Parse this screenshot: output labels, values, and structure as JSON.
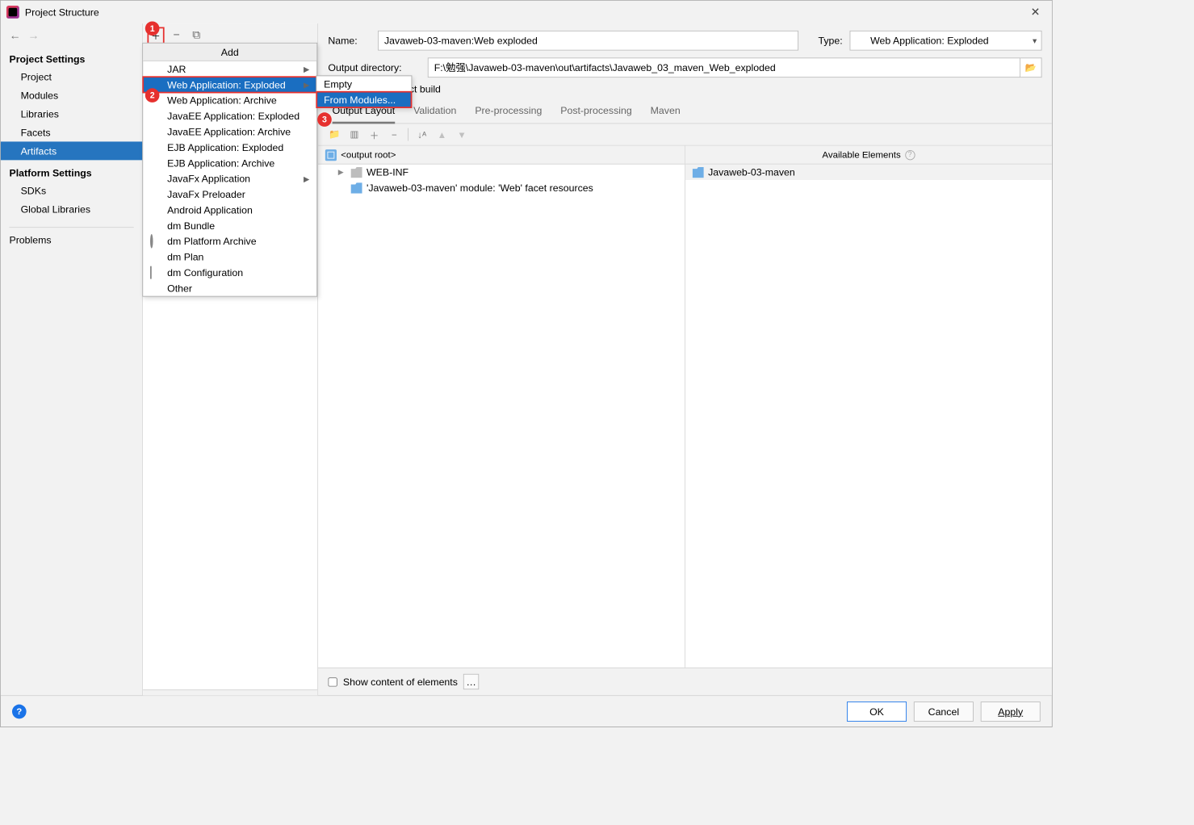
{
  "window": {
    "title": "Project Structure"
  },
  "sidebar": {
    "sections": [
      {
        "title": "Project Settings",
        "items": [
          "Project",
          "Modules",
          "Libraries",
          "Facets",
          "Artifacts"
        ],
        "selected": "Artifacts"
      },
      {
        "title": "Platform Settings",
        "items": [
          "SDKs",
          "Global Libraries"
        ]
      }
    ],
    "problems": "Problems"
  },
  "popup": {
    "title": "Add",
    "items": [
      "JAR",
      "Web Application: Exploded",
      "Web Application: Archive",
      "JavaEE Application: Exploded",
      "JavaEE Application: Archive",
      "EJB Application: Exploded",
      "EJB Application: Archive",
      "JavaFx Application",
      "JavaFx Preloader",
      "Android Application",
      "dm Bundle",
      "dm Platform Archive",
      "dm Plan",
      "dm Configuration",
      "Other"
    ],
    "highlightIndex": 1,
    "sub": {
      "items": [
        "Empty",
        "From Modules..."
      ],
      "highlightIndex": 1
    }
  },
  "callouts": {
    "one": "1",
    "two": "2",
    "three": "3"
  },
  "detail": {
    "nameLabel": "Name:",
    "nameValue": "Javaweb-03-maven:Web exploded",
    "typeLabel": "Type:",
    "typeValue": "Web Application: Exploded",
    "outLabel": "Output directory:",
    "outValue": "F:\\勉强\\Javaweb-03-maven\\out\\artifacts\\Javaweb_03_maven_Web_exploded",
    "includeLabel": "Include in project build",
    "tabs": [
      "Output Layout",
      "Validation",
      "Pre-processing",
      "Post-processing",
      "Maven"
    ],
    "activeTab": 0,
    "leftTree": {
      "root": "<output root>",
      "child1": "WEB-INF",
      "child2": "'Javaweb-03-maven' module: 'Web' facet resources"
    },
    "rightHeader": "Available Elements",
    "rightItem": "Javaweb-03-maven",
    "showContent": "Show content of elements"
  },
  "buttons": {
    "ok": "OK",
    "cancel": "Cancel",
    "apply": "Apply"
  }
}
